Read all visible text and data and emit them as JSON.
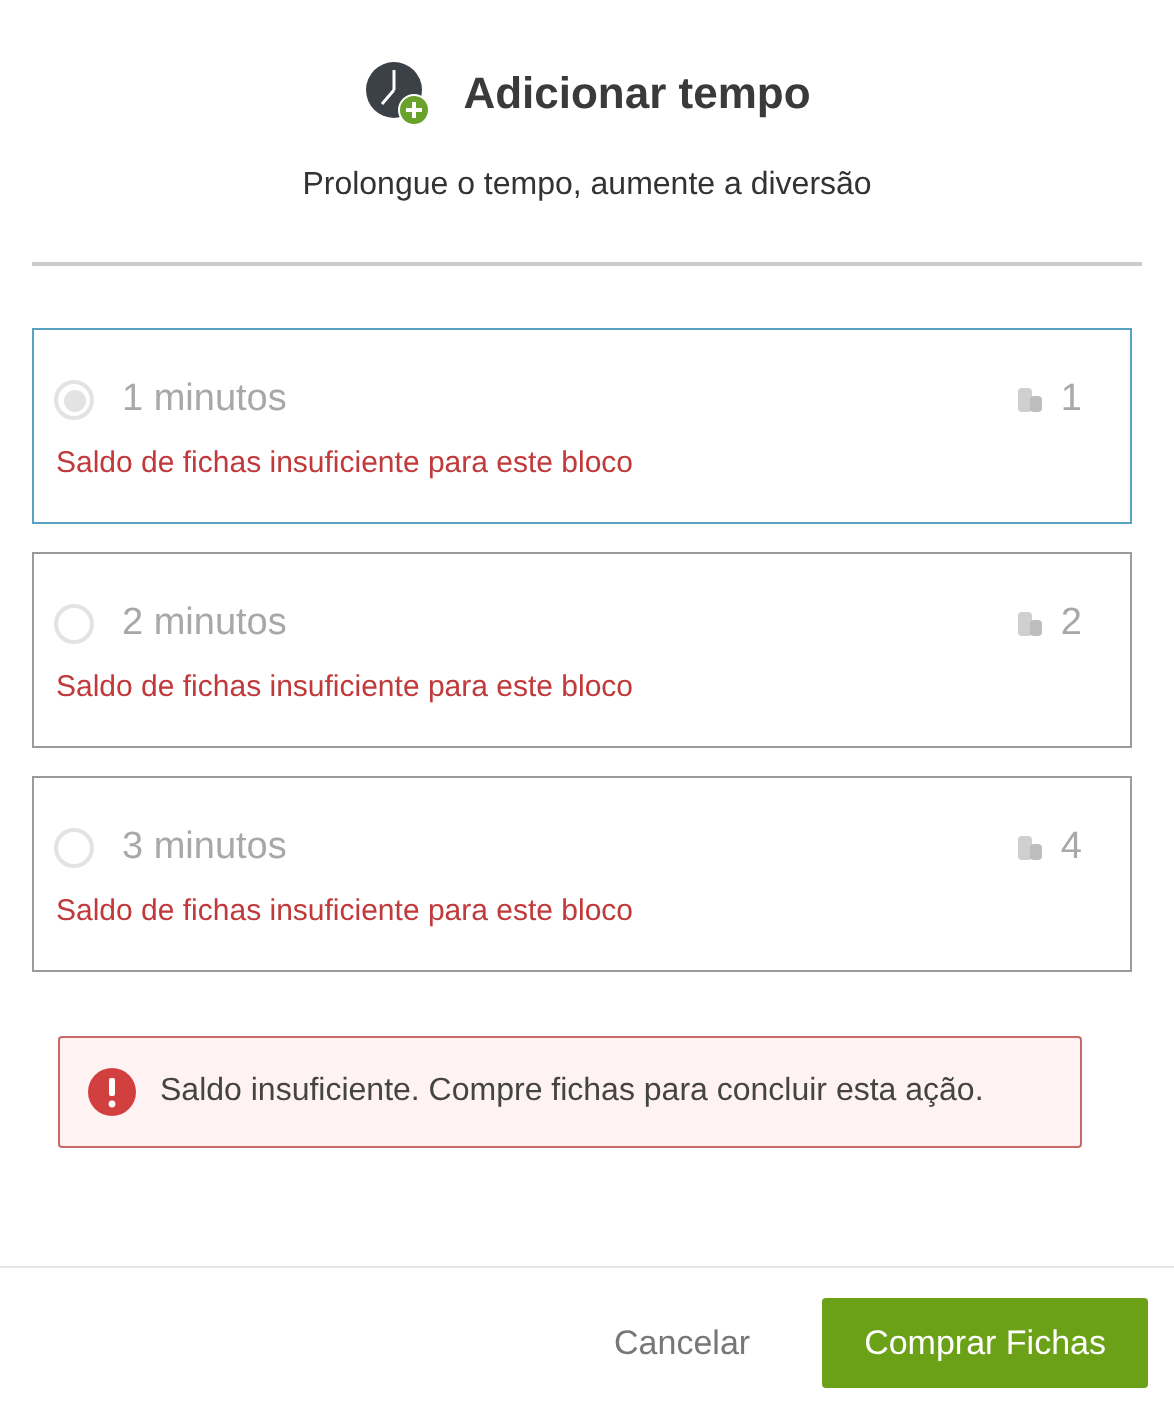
{
  "header": {
    "title": "Adicionar tempo",
    "subtitle": "Prolongue o tempo, aumente a diversão"
  },
  "options": [
    {
      "label": "1 minutos",
      "cost": "1",
      "message": "Saldo de fichas insuficiente para este bloco",
      "selected": true,
      "disabled": true
    },
    {
      "label": "2 minutos",
      "cost": "2",
      "message": "Saldo de fichas insuficiente para este bloco",
      "selected": false,
      "disabled": true
    },
    {
      "label": "3 minutos",
      "cost": "4",
      "message": "Saldo de fichas insuficiente para este bloco",
      "selected": false,
      "disabled": true
    }
  ],
  "alert": {
    "message": "Saldo insuficiente. Compre fichas para concluir esta ação."
  },
  "buttons": {
    "cancel": "Cancelar",
    "confirm": "Comprar Fichas"
  }
}
